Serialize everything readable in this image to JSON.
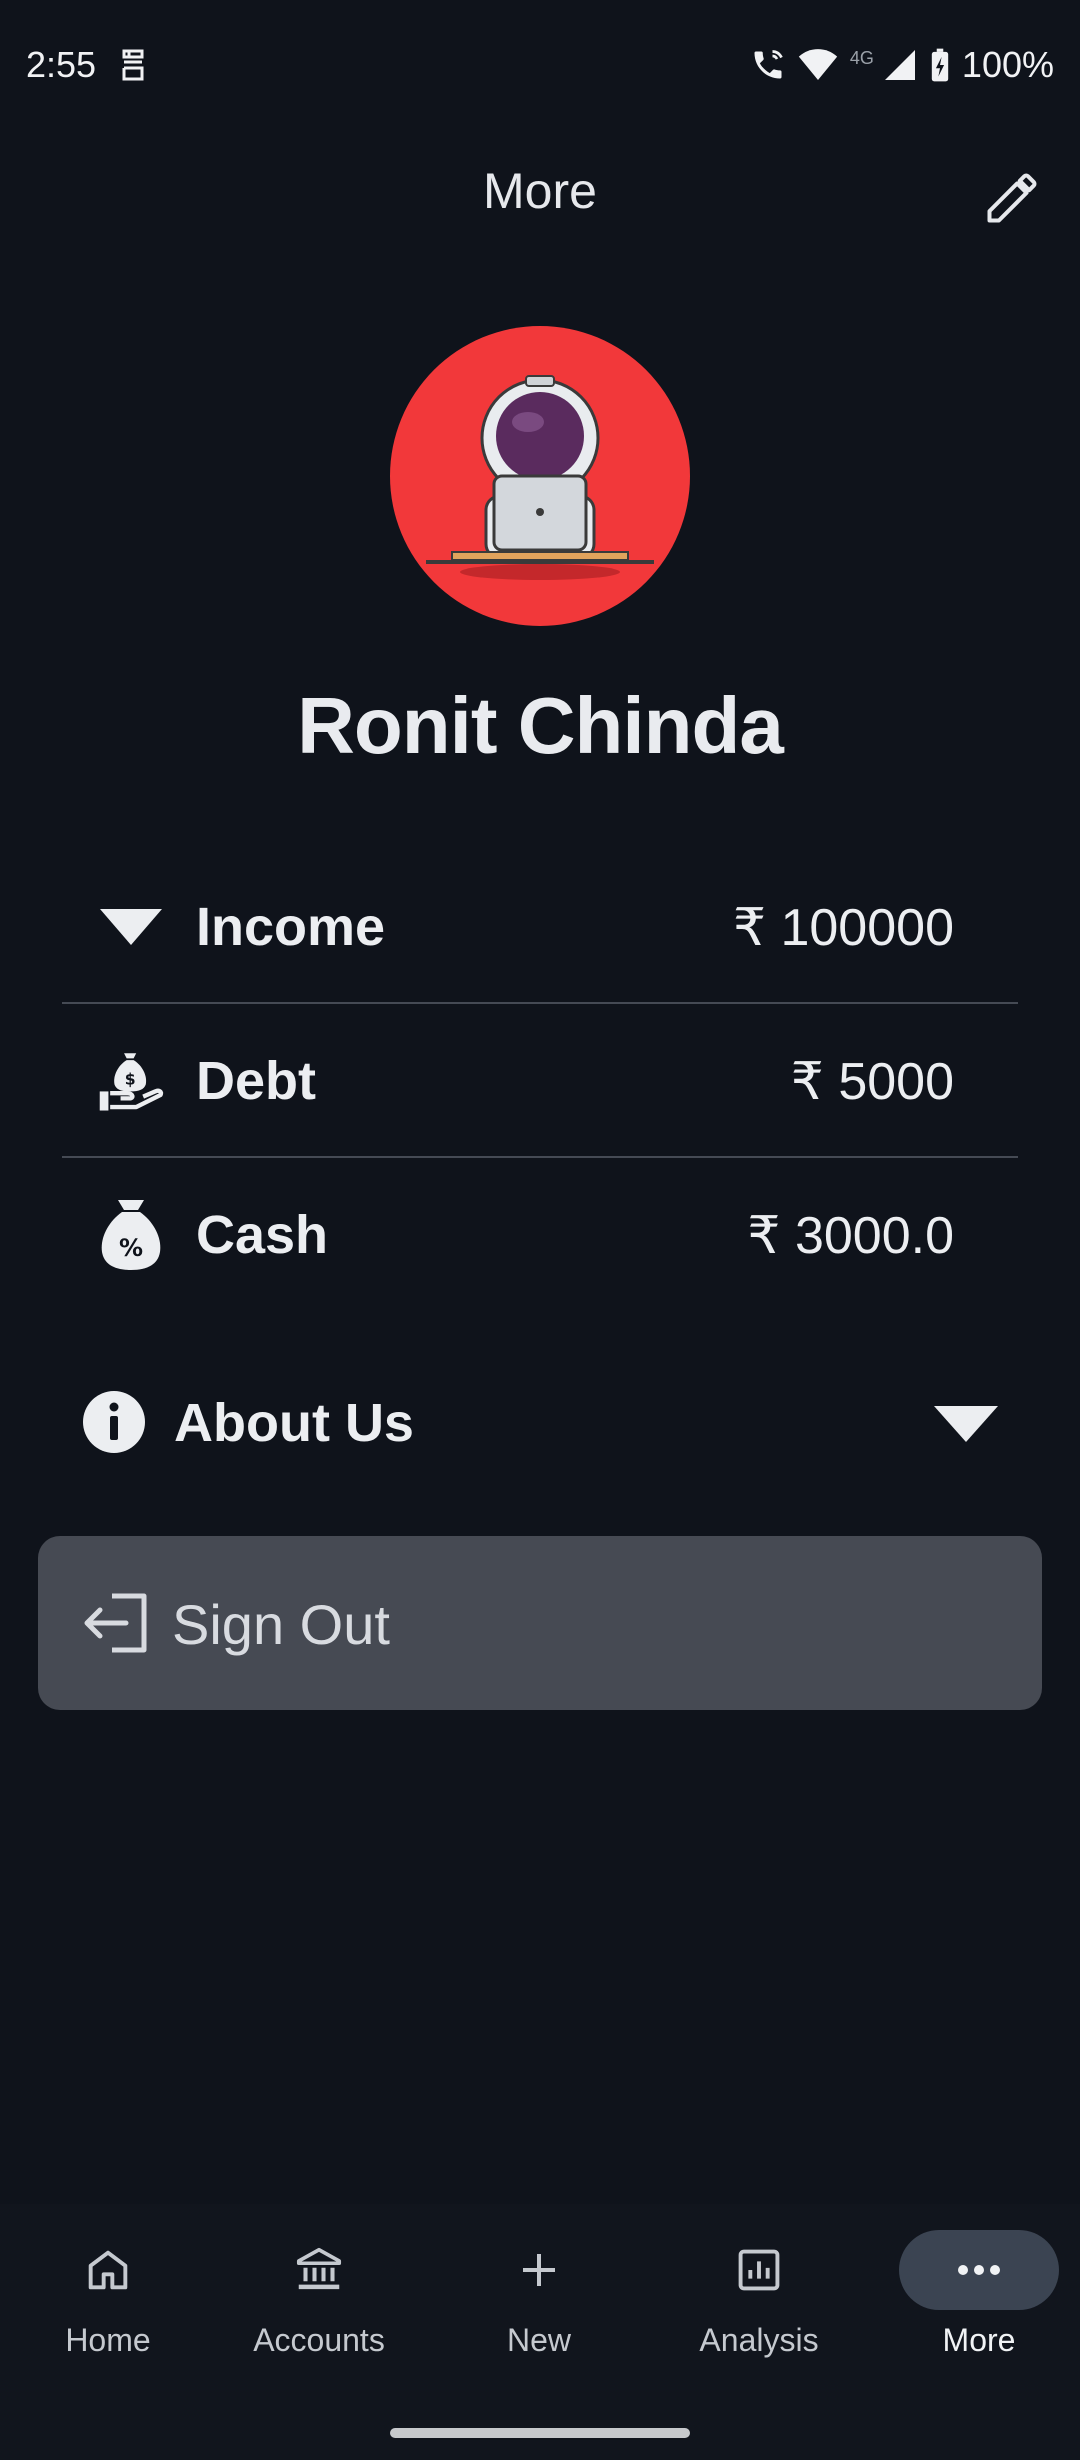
{
  "status_bar": {
    "time": "2:55",
    "network_label": "4G",
    "battery_text": "100%"
  },
  "header": {
    "title": "More"
  },
  "profile": {
    "name": "Ronit Chinda",
    "avatar_color": "#f2383a"
  },
  "finance": {
    "items": [
      {
        "label": "Income",
        "value": "₹ 100000",
        "icon": "triangle-down-icon"
      },
      {
        "label": "Debt",
        "value": "₹ 5000",
        "icon": "money-bag-hand-icon"
      },
      {
        "label": "Cash",
        "value": "₹ 3000.0",
        "icon": "percent-bag-icon"
      }
    ]
  },
  "about": {
    "label": "About Us"
  },
  "signout": {
    "label": "Sign Out"
  },
  "bottom_nav": {
    "items": [
      {
        "label": "Home",
        "icon": "home-icon"
      },
      {
        "label": "Accounts",
        "icon": "bank-icon"
      },
      {
        "label": "New",
        "icon": "plus-icon"
      },
      {
        "label": "Analysis",
        "icon": "chart-icon"
      },
      {
        "label": "More",
        "icon": "more-dots-icon",
        "active": true
      }
    ]
  },
  "colors": {
    "background": "#0f131b",
    "card": "#464a53",
    "active_nav": "#3b4452",
    "divider": "#454a54"
  }
}
